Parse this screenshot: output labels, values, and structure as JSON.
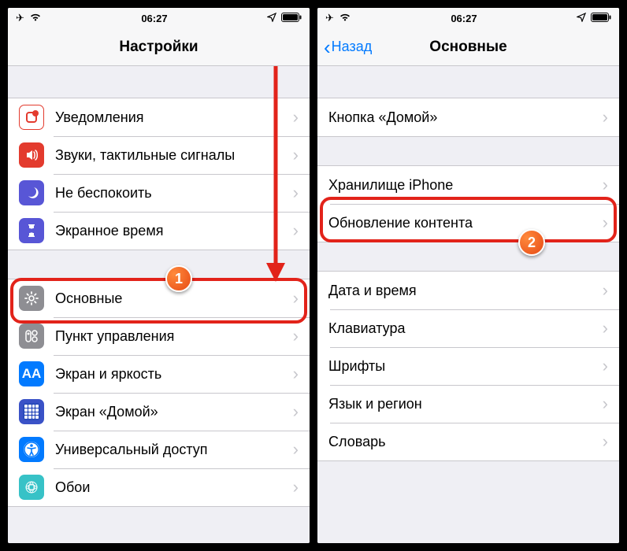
{
  "statusbar": {
    "time": "06:27"
  },
  "left": {
    "title": "Настройки",
    "group1": {
      "notifications": "Уведомления",
      "sounds": "Звуки, тактильные сигналы",
      "dnd": "Не беспокоить",
      "screentime": "Экранное время"
    },
    "group2": {
      "general": "Основные",
      "control": "Пункт управления",
      "display": "Экран и яркость",
      "home": "Экран «Домой»",
      "accessibility": "Универсальный доступ",
      "wallpaper": "Обои"
    }
  },
  "right": {
    "back": "Назад",
    "title": "Основные",
    "group1": {
      "homebutton": "Кнопка «Домой»"
    },
    "group2": {
      "storage": "Хранилище iPhone",
      "refresh": "Обновление контента"
    },
    "group3": {
      "datetime": "Дата и время",
      "keyboard": "Клавиатура",
      "fonts": "Шрифты",
      "language": "Язык и регион",
      "dictionary": "Словарь"
    }
  },
  "badges": {
    "one": "1",
    "two": "2"
  }
}
